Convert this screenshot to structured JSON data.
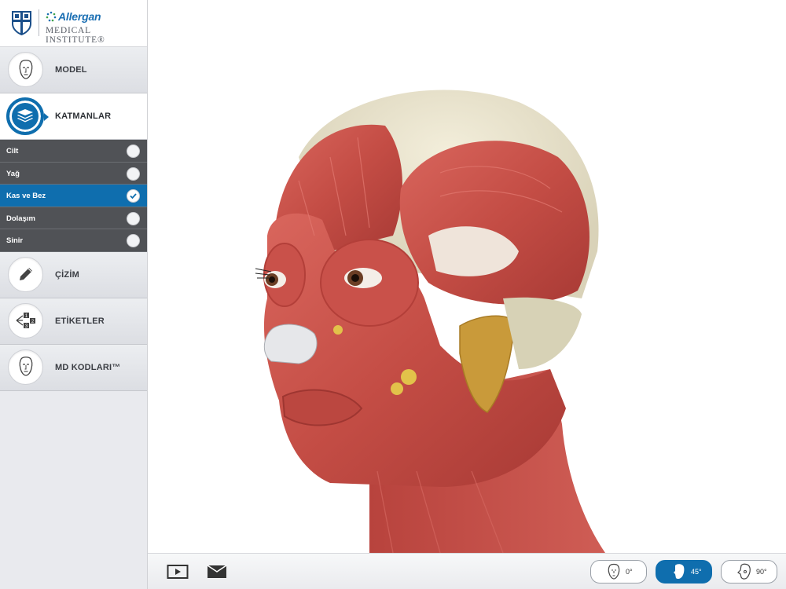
{
  "logo": {
    "brand": "Allergan",
    "institute": "MEDICAL INSTITUTE®"
  },
  "nav": {
    "model_label": "MODEL",
    "layers_label": "KATMANLAR",
    "drawing_label": "ÇİZİM",
    "labels_label": "ETİKETLER",
    "mdcodes_label": "MD KODLARI™"
  },
  "layers": [
    {
      "name": "Cilt",
      "checked": false
    },
    {
      "name": "Yağ",
      "checked": false
    },
    {
      "name": "Kas ve Bez",
      "checked": true
    },
    {
      "name": "Dolaşım",
      "checked": false
    },
    {
      "name": "Sinir",
      "checked": false
    }
  ],
  "toolbar": {
    "angles": [
      {
        "label": "0°",
        "selected": false
      },
      {
        "label": "45°",
        "selected": true
      },
      {
        "label": "90°",
        "selected": false
      }
    ]
  },
  "colors": {
    "accent": "#0f6eae",
    "layer_bg": "#505256",
    "muscle": "#c9514a"
  },
  "icons": {
    "model": "face-icon",
    "layers": "layers-stack-icon",
    "drawing": "pencil-icon",
    "labels": "numbered-labels-icon",
    "mdcodes": "face-icon",
    "play": "play-icon",
    "mail": "mail-icon"
  }
}
